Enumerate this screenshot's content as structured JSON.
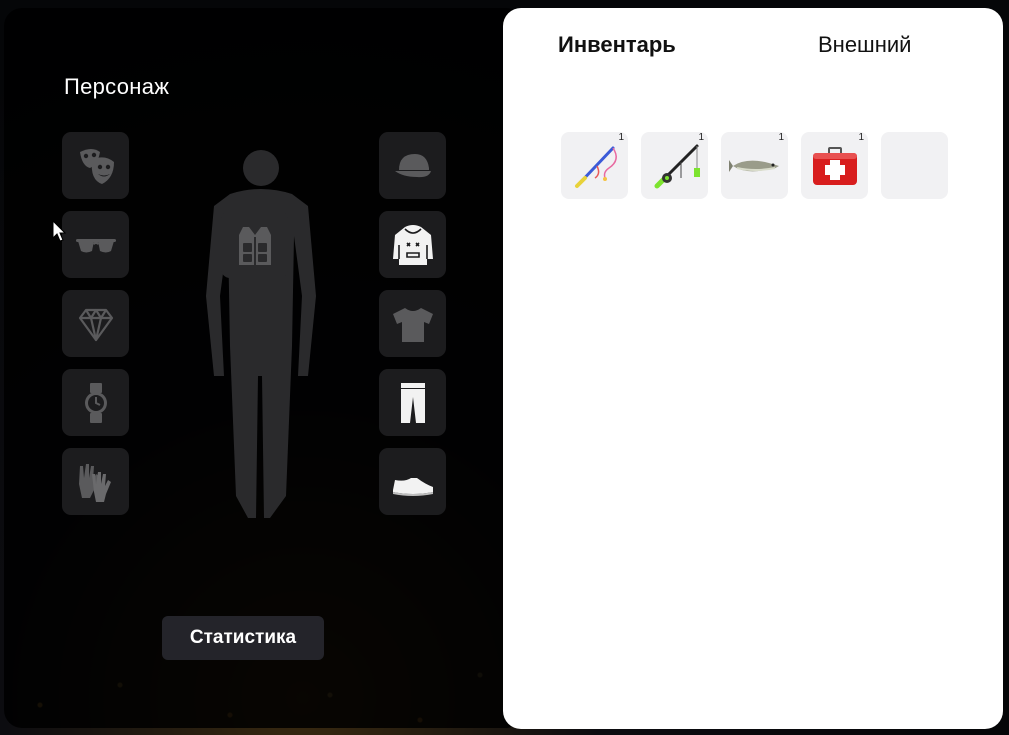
{
  "character": {
    "title": "Персонаж",
    "left_slots": [
      {
        "icon": "mask-icon"
      },
      {
        "icon": "glasses-icon"
      },
      {
        "icon": "diamond-icon"
      },
      {
        "icon": "watch-icon"
      },
      {
        "icon": "gloves-icon"
      }
    ],
    "right_slots": [
      {
        "icon": "cap-icon"
      },
      {
        "icon": "hoodie-icon"
      },
      {
        "icon": "tshirt-icon"
      },
      {
        "icon": "pants-icon"
      },
      {
        "icon": "sneaker-icon"
      }
    ],
    "center_slot": {
      "icon": "vest-icon"
    },
    "stats_button_label": "Статистика"
  },
  "inventory": {
    "tabs": [
      {
        "label": "Инвентарь",
        "active": true
      },
      {
        "label": "Внешний",
        "active": false
      }
    ],
    "items": [
      {
        "icon": "fishing-rod-pink-icon",
        "qty": "1"
      },
      {
        "icon": "fishing-rod-green-icon",
        "qty": "1"
      },
      {
        "icon": "fish-icon",
        "qty": "1"
      },
      {
        "icon": "first-aid-kit-icon",
        "qty": "1"
      },
      {
        "icon": "empty-slot",
        "qty": ""
      }
    ]
  },
  "colors": {
    "panel_dark": "#000000",
    "slot_dark": "#1c1c1e",
    "panel_light": "#ffffff",
    "slot_light": "#f1f1f3",
    "button_bg": "#24242a"
  }
}
